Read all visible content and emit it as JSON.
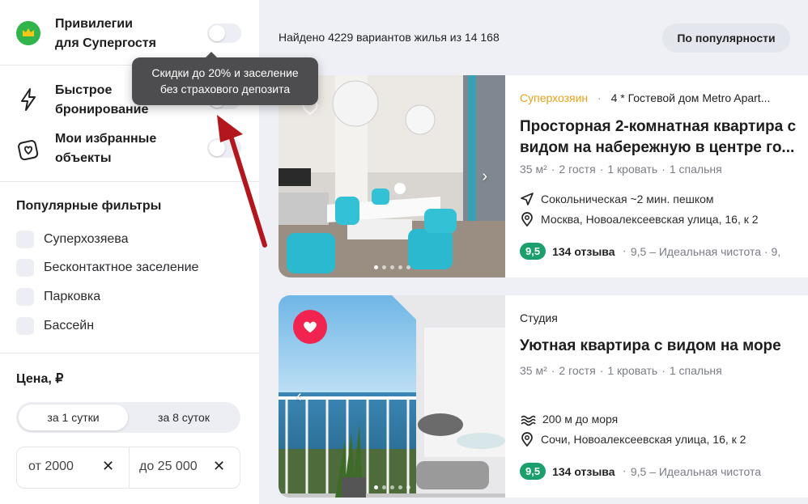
{
  "sidebar": {
    "toggles": [
      {
        "label_line1": "Привилегии",
        "label_line2": "для Супергостя",
        "icon": "crown-icon",
        "enabled": false
      },
      {
        "label_line1": "Быстрое",
        "label_line2": "бронирование",
        "icon": "lightning-icon",
        "enabled": false
      },
      {
        "label_line1": "Мои избранные",
        "label_line2": "объекты",
        "icon": "favorites-heart-icon",
        "enabled": false
      }
    ],
    "popular_title": "Популярные фильтры",
    "popular_filters": [
      {
        "label": "Суперхозяева",
        "checked": false
      },
      {
        "label": "Бесконтактное заселение",
        "checked": false
      },
      {
        "label": "Парковка",
        "checked": false
      },
      {
        "label": "Бассейн",
        "checked": false
      }
    ],
    "price_title": "Цена, ₽",
    "price_period": {
      "options": [
        "за 1 сутки",
        "за 8 суток"
      ],
      "selected": "за 1 сутки"
    },
    "price_from": "от 2000",
    "price_to": "до 25 000"
  },
  "tooltip": {
    "line1": "Скидки до 20% и заселение",
    "line2": "без страхового депозита"
  },
  "results": {
    "found_text": "Найдено 4229 вариантов жилья из 14 168",
    "sort_label": "По популярности",
    "listings": [
      {
        "superhost": "Суперхозяин",
        "hotel": "4 * Гостевой дом Metro Apart...",
        "title_line1": "Просторная 2-комнатная квартира с",
        "title_line2": "видом на набережную в центре го...",
        "area": "35 м²",
        "guests": "2 гостя",
        "beds": "1 кровать",
        "bedrooms": "1 спальня",
        "line1": "Сокольническая ~2 мин. пешком",
        "line1_icon": "navigation-arrow-icon",
        "address": "Москва, Новоалексеевская улица, 16, к 2",
        "score": "9,5",
        "reviews": "134 отзыва",
        "cleanliness": "9,5 – Идеальная чистота · 9,",
        "favorite": false
      },
      {
        "type": "Студия",
        "title_line1": "Уютная квартира с видом на море",
        "area": "35 м²",
        "guests": "2 гостя",
        "beds": "1 кровать",
        "bedrooms": "1 спальня",
        "line1": "200 м до моря",
        "line1_icon": "waves-icon",
        "address": "Сочи, Новоалексеевская улица, 16, к 2",
        "score": "9,5",
        "reviews": "134 отзыва",
        "cleanliness": "9,5 – Идеальная чистота",
        "favorite": true
      }
    ]
  },
  "colors": {
    "accent_green": "#1aa06a",
    "superhost_gold": "#e3a21a",
    "favorite_red": "#f0244e",
    "annotation_arrow": "#b3161c"
  }
}
